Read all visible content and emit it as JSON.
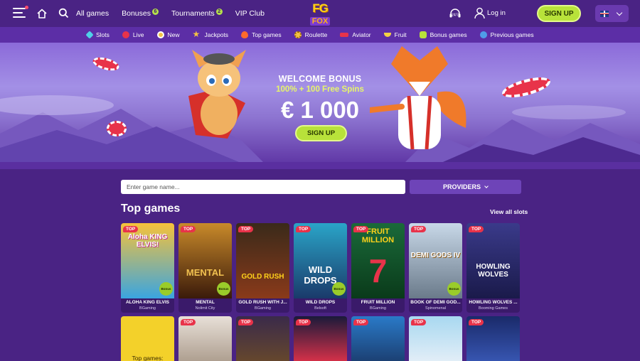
{
  "header": {
    "nav": [
      {
        "label": "All games",
        "badge": ""
      },
      {
        "label": "Bonuses",
        "badge": "6"
      },
      {
        "label": "Tournaments",
        "badge": "2"
      },
      {
        "label": "VIP Club",
        "badge": ""
      }
    ],
    "logo_top": "FG",
    "logo_bottom": "FOX",
    "login": "Log in",
    "signup": "SIGN UP"
  },
  "categories": [
    {
      "label": "Slots",
      "icon": "diamond-icon",
      "color": "#4fd1e8"
    },
    {
      "label": "Live",
      "icon": "live-icon",
      "color": "#e8334a"
    },
    {
      "label": "New",
      "icon": "new-icon",
      "color": "#f3c244"
    },
    {
      "label": "Jackpots",
      "icon": "star-icon",
      "color": "#f3c244"
    },
    {
      "label": "Top games",
      "icon": "fire-icon",
      "color": "#ff6a2a"
    },
    {
      "label": "Roulette",
      "icon": "roulette-icon",
      "color": "#f3c244"
    },
    {
      "label": "Aviator",
      "icon": "plane-icon",
      "color": "#e8334a"
    },
    {
      "label": "Fruit",
      "icon": "banana-icon",
      "color": "#f3d144"
    },
    {
      "label": "Bonus games",
      "icon": "bonus-icon",
      "color": "#b8e23a"
    },
    {
      "label": "Previous games",
      "icon": "history-icon",
      "color": "#4f9de8"
    }
  ],
  "hero": {
    "title": "WELCOME BONUS",
    "subtitle": "100% + 100 Free Spins",
    "amount": "€ 1 000",
    "cta": "SIGN UP"
  },
  "search": {
    "placeholder": "Enter game name...",
    "providers": "PROVIDERS"
  },
  "section": {
    "title": "Top games",
    "view_all": "View all slots"
  },
  "games": [
    {
      "name": "ALOHA KING ELVIS",
      "provider": "BGaming",
      "badge": "TOP",
      "bonus": "Bonus",
      "art": "Aloha KING ELVIS!",
      "color1": "#f7c23a",
      "color2": "#3aa5e0"
    },
    {
      "name": "MENTAL",
      "provider": "Nolimit City",
      "badge": "TOP",
      "bonus": "Bonus",
      "art": "MENTAL",
      "color1": "#c98a2a",
      "color2": "#3a1a0a"
    },
    {
      "name": "GOLD RUSH WITH J...",
      "provider": "BGaming",
      "badge": "TOP",
      "bonus": "",
      "art": "GOLD RUSH",
      "color1": "#3a2a1a",
      "color2": "#8a3a1a"
    },
    {
      "name": "WILD DROPS",
      "provider": "Belsoft",
      "badge": "TOP",
      "bonus": "Bonus",
      "art": "WILD DROPS",
      "color1": "#2aa5c8",
      "color2": "#1a3a6a"
    },
    {
      "name": "FRUIT MILLION",
      "provider": "BGaming",
      "badge": "TOP",
      "bonus": "",
      "art": "FRUIT MILLION",
      "color1": "#1a6a3a",
      "color2": "#0a3a1a"
    },
    {
      "name": "BOOK OF DEMI GOD...",
      "provider": "Spinomenal",
      "badge": "TOP",
      "bonus": "Bonus",
      "art": "DEMI GODS IV",
      "color1": "#c8d8e8",
      "color2": "#6a7a8a"
    },
    {
      "name": "HOWLING WOLVES ...",
      "provider": "Booming Games",
      "badge": "TOP",
      "bonus": "",
      "art": "HOWLING WOLVES",
      "color1": "#3a3a8a",
      "color2": "#1a1a4a"
    }
  ],
  "games_row2": [
    {
      "badge": "",
      "label": "Top games:",
      "color1": "#f3d12a",
      "color2": "#f3c21a"
    },
    {
      "badge": "TOP",
      "label": "",
      "color1": "#e8e0d8",
      "color2": "#a89888"
    },
    {
      "badge": "TOP",
      "label": "",
      "color1": "#3a2a4a",
      "color2": "#6a4a2a"
    },
    {
      "badge": "TOP",
      "label": "",
      "color1": "#1a1a3a",
      "color2": "#e8334a"
    },
    {
      "badge": "TOP",
      "label": "",
      "color1": "#2a7ac8",
      "color2": "#1a3a6a"
    },
    {
      "badge": "TOP",
      "label": "",
      "color1": "#a8d8f0",
      "color2": "#e8f0f8"
    },
    {
      "badge": "TOP",
      "label": "",
      "color1": "#1a2a6a",
      "color2": "#3a5ab8"
    }
  ]
}
